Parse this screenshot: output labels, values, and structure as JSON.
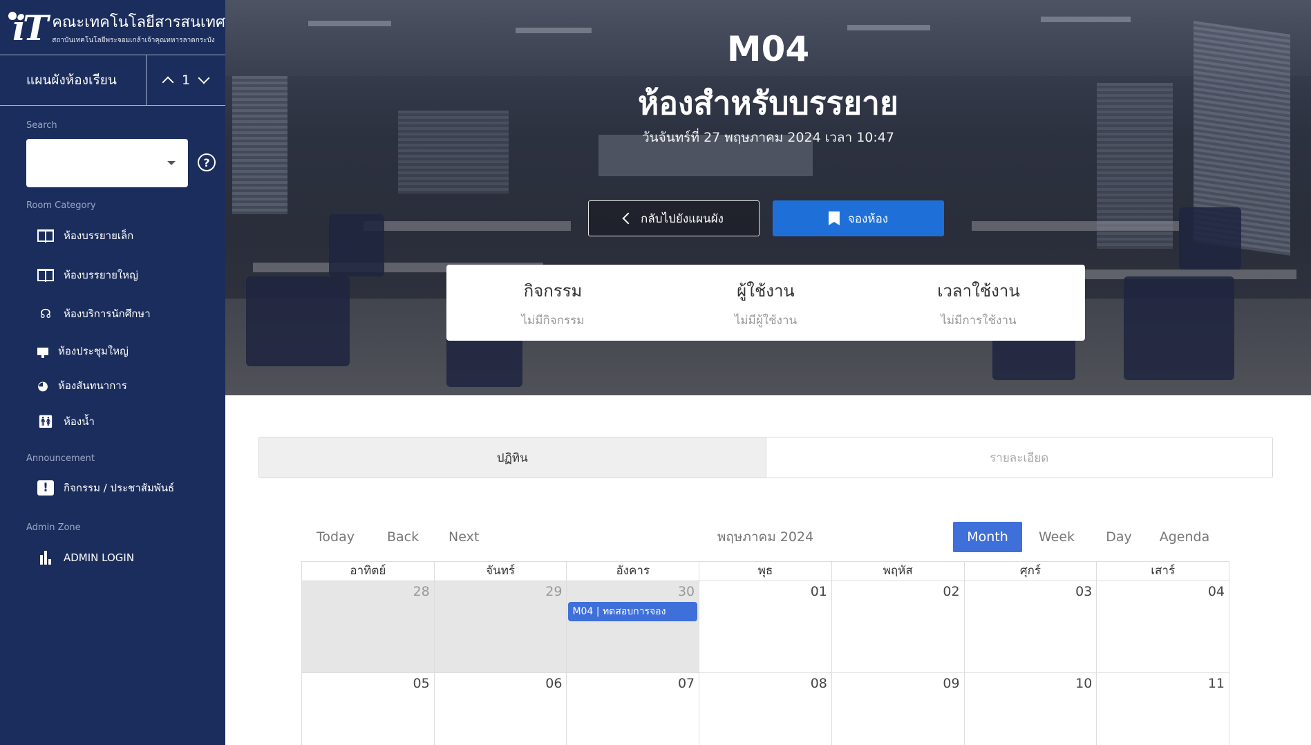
{
  "brand": {
    "logo_text": "iT",
    "title": "คณะเทคโนโลยีสารสนเทศ",
    "subtitle": "สถาบันเทคโนโลยีพระจอมเกล้าเจ้าคุณทหารลาดกระบัง"
  },
  "floor_plan": {
    "title": "แผนผังห้องเรียน",
    "floor": "1"
  },
  "search": {
    "label": "Search",
    "value": ""
  },
  "room_category": {
    "label": "Room Category",
    "items": [
      {
        "label": "ห้องบรรยายเล็ก",
        "icon": "book-open-icon"
      },
      {
        "label": "ห้องบรรยายใหญ่",
        "icon": "book-open-icon"
      },
      {
        "label": "ห้องบริการนักศึกษา",
        "icon": "headset-icon"
      },
      {
        "label": "ห้องประชุมใหญ่",
        "icon": "presentation-icon"
      },
      {
        "label": "ห้องสันทนาการ",
        "icon": "palette-icon"
      },
      {
        "label": "ห้องน้ำ",
        "icon": "restroom-icon"
      }
    ]
  },
  "announcement": {
    "label": "Announcement",
    "items": [
      {
        "label": "กิจกรรม / ประชาสัมพันธ์",
        "icon": "alert-box-icon"
      }
    ]
  },
  "admin_zone": {
    "label": "Admin Zone",
    "items": [
      {
        "label": "ADMIN LOGIN",
        "icon": "bar-chart-icon"
      }
    ]
  },
  "hero": {
    "room_code": "M04",
    "room_type": "ห้องสำหรับบรรยาย",
    "datetime": "วันจันทร์ที่ 27 พฤษภาคม 2024 เวลา 10:47",
    "back_button": "กลับไปยังแผนผัง",
    "book_button": "จองห้อง"
  },
  "info": {
    "activity": {
      "title": "กิจกรรม",
      "value": "ไม่มีกิจกรรม"
    },
    "user": {
      "title": "ผู้ใช้งาน",
      "value": "ไม่มีผู้ใช้งาน"
    },
    "time": {
      "title": "เวลาใช้งาน",
      "value": "ไม่มีการใช้งาน"
    }
  },
  "tabs": [
    {
      "label": "ปฏิทิน",
      "active": true
    },
    {
      "label": "รายละเอียด",
      "active": false
    }
  ],
  "calendar": {
    "toolbar": {
      "today": "Today",
      "back": "Back",
      "next": "Next"
    },
    "label": "พฤษภาคม 2024",
    "views": [
      {
        "label": "Month",
        "active": true
      },
      {
        "label": "Week",
        "active": false
      },
      {
        "label": "Day",
        "active": false
      },
      {
        "label": "Agenda",
        "active": false
      }
    ],
    "weekdays": [
      "อาทิตย์",
      "จันทร์",
      "อังคาร",
      "พุธ",
      "พฤหัส",
      "ศุกร์",
      "เสาร์"
    ],
    "weeks": [
      [
        {
          "day": "28",
          "off": true
        },
        {
          "day": "29",
          "off": true
        },
        {
          "day": "30",
          "off": true,
          "event": "M04 | ทดสอบการจอง"
        },
        {
          "day": "01",
          "off": false
        },
        {
          "day": "02",
          "off": false
        },
        {
          "day": "03",
          "off": false
        },
        {
          "day": "04",
          "off": false
        }
      ],
      [
        {
          "day": "05",
          "off": false
        },
        {
          "day": "06",
          "off": false
        },
        {
          "day": "07",
          "off": false
        },
        {
          "day": "08",
          "off": false
        },
        {
          "day": "09",
          "off": false
        },
        {
          "day": "10",
          "off": false
        },
        {
          "day": "11",
          "off": false
        }
      ]
    ]
  },
  "colors": {
    "sidebar": "#1b2d5c",
    "primary_button": "#1e70d8",
    "calendar_active": "#3f6fd9"
  }
}
